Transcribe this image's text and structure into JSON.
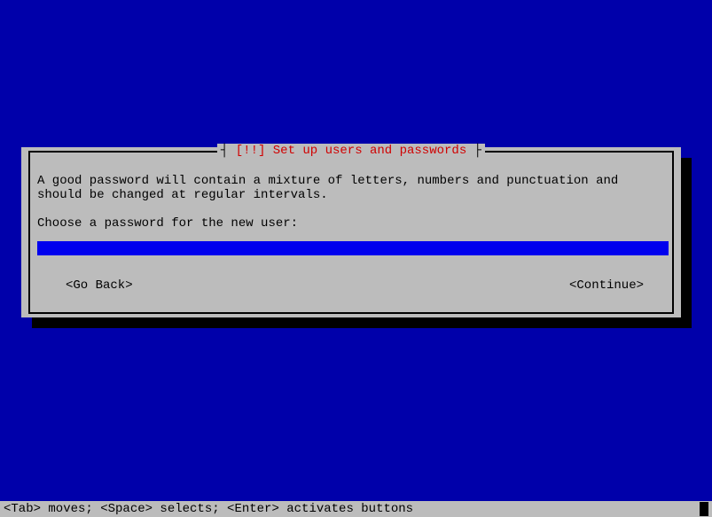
{
  "dialog": {
    "title_mark": "[!!]",
    "title_text": "Set up users and passwords",
    "help_text": "A good password will contain a mixture of letters, numbers and punctuation and should be changed at regular intervals.",
    "prompt": "Choose a password for the new user:",
    "password_value": "",
    "buttons": {
      "back": "<Go Back>",
      "continue": "<Continue>"
    }
  },
  "status_bar": {
    "text": "<Tab> moves; <Space> selects; <Enter> activates buttons"
  }
}
